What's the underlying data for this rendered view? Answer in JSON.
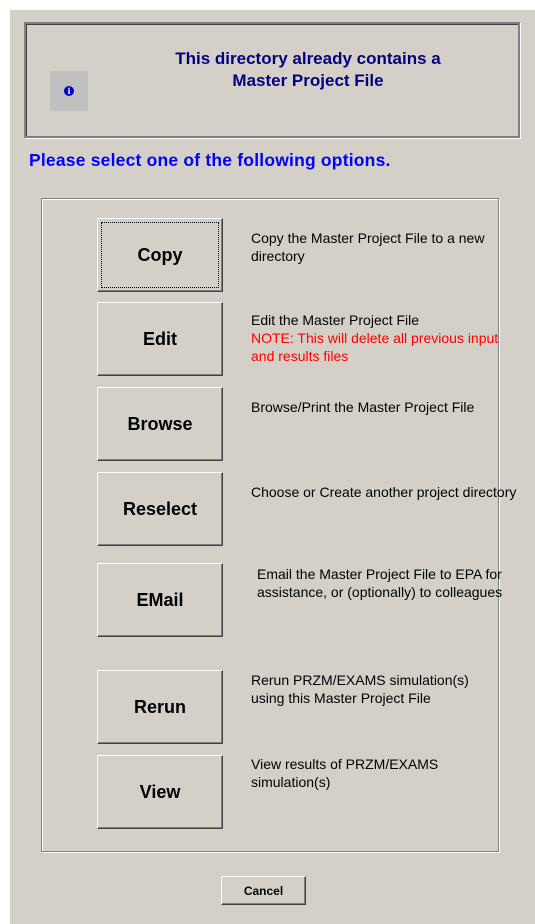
{
  "header": {
    "title": "This directory already contains a\nMaster Project File",
    "icon": "info-icon",
    "icon_color": "#0000cc"
  },
  "prompt": "Please select one of the following options.",
  "options": [
    {
      "label": "Copy",
      "description": "Copy the Master Project File to a new directory",
      "note": ""
    },
    {
      "label": "Edit",
      "description": "Edit the Master Project File",
      "note": "NOTE:  This will delete all previous input and results files"
    },
    {
      "label": "Browse",
      "description": "Browse/Print the Master Project File",
      "note": ""
    },
    {
      "label": "Reselect",
      "description": "Choose or Create another project directory",
      "note": ""
    },
    {
      "label": "EMail",
      "description": "Email the Master Project File to EPA for assistance, or (optionally)  to colleagues",
      "note": ""
    },
    {
      "label": "Rerun",
      "description": "Rerun PRZM/EXAMS simulation(s) using this Master Project File",
      "note": ""
    },
    {
      "label": "View",
      "description": "View results of PRZM/EXAMS simulation(s)",
      "note": ""
    }
  ],
  "cancel_label": "Cancel",
  "colors": {
    "dialog_bg": "#d4d0c8",
    "title_color": "#000080",
    "prompt_color": "#0000ff",
    "note_color": "#ff0000"
  }
}
